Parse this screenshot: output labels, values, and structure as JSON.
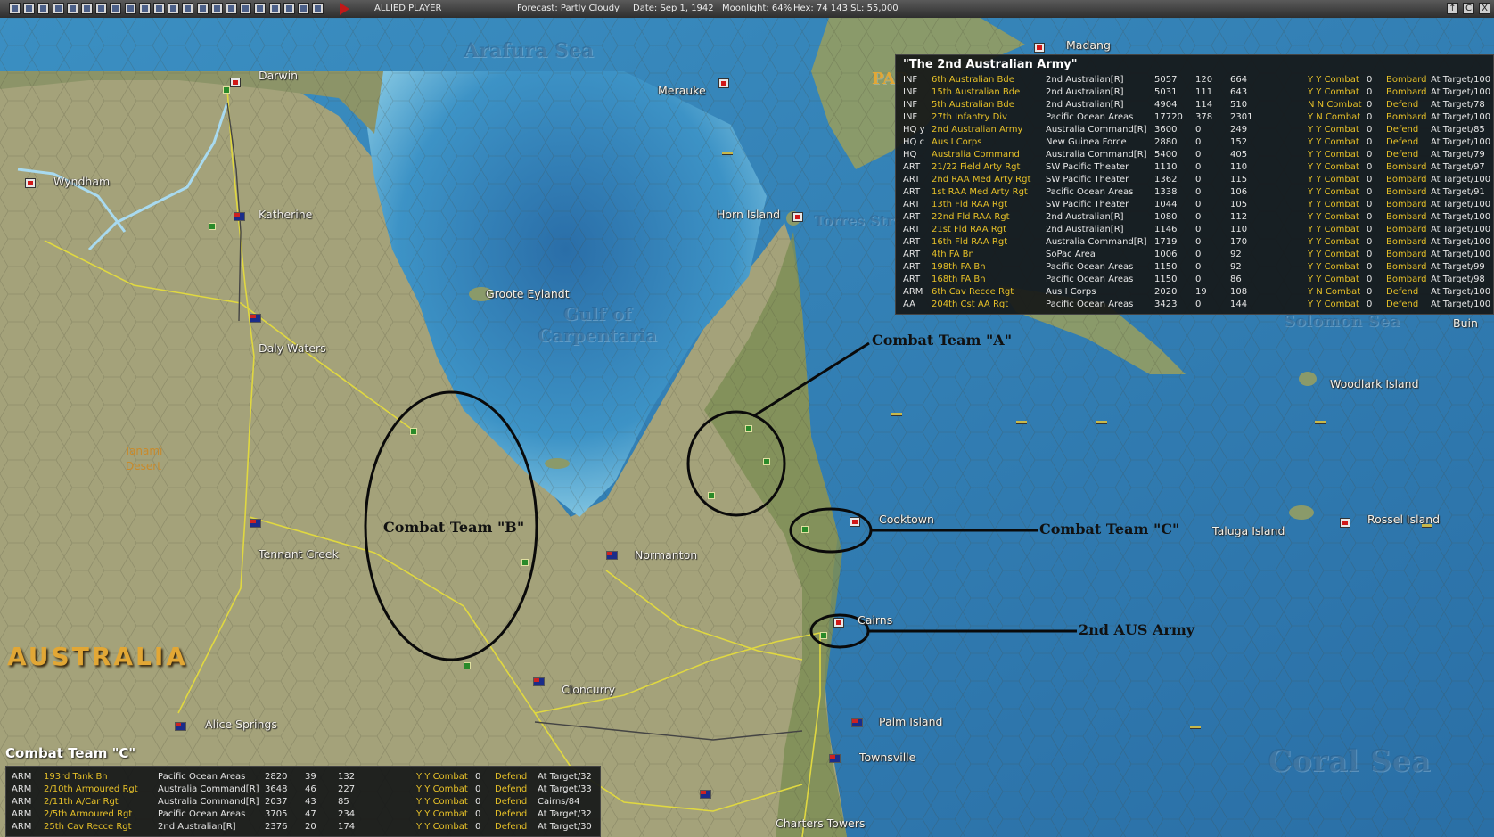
{
  "toolbar": {
    "player": "ALLIED PLAYER",
    "forecast": "Forecast: Partly Cloudy",
    "date": "Date: Sep 1, 1942",
    "moonlight": "Moonlight: 64%",
    "hex": "Hex: 74 143 SL: 55,000",
    "right_buttons": [
      "↑",
      "C",
      "X"
    ],
    "icon_count": 22
  },
  "map": {
    "places": [
      "Darwin",
      "Wyndham",
      "Katherine",
      "Daly Waters",
      "Tennant Creek",
      "Alice Springs",
      "Groote Eylandt",
      "Merauke",
      "Horn Island",
      "Normanton",
      "Cloncurry",
      "Cooktown",
      "Cairns",
      "Palm Island",
      "Townsville",
      "Charters Towers",
      "Taluga Island",
      "Rossel Island",
      "Woodlark Island",
      "Madang",
      "Buin"
    ],
    "seas": [
      "Arafura Sea",
      "Gulf of Carpentaria",
      "Torres Strait",
      "Coral Sea",
      "Solomon Sea"
    ],
    "partial_labels": [
      "PAP"
    ],
    "desert": "Tanami Desert",
    "country": "AUSTRALIA",
    "annotations": [
      "Combat Team \"A\"",
      "Combat Team \"B\"",
      "Combat Team \"C\"",
      "2nd AUS Army"
    ],
    "colors": {
      "sea": "#3a8fc4",
      "land": "#8c8a66",
      "road": "#e0d840",
      "river": "#9fd3ea"
    }
  },
  "army_panel": {
    "title": "\"The 2nd Australian Army\"",
    "rows": [
      [
        "INF",
        "6th Australian Bde",
        "2nd Australian[R]",
        "5057",
        "120",
        "664",
        "Y Y Combat",
        "0",
        "Bombard",
        "At Target/100"
      ],
      [
        "INF",
        "15th Australian Bde",
        "2nd Australian[R]",
        "5031",
        "111",
        "643",
        "Y Y Combat",
        "0",
        "Bombard",
        "At Target/100"
      ],
      [
        "INF",
        "5th Australian Bde",
        "2nd Australian[R]",
        "4904",
        "114",
        "510",
        "N N Combat",
        "0",
        "Defend",
        "At Target/78"
      ],
      [
        "INF",
        "27th Infantry Div",
        "Pacific Ocean Areas",
        "17720",
        "378",
        "2301",
        "Y N Combat",
        "0",
        "Bombard",
        "At Target/100"
      ],
      [
        "HQ y",
        "2nd Australian Army",
        "Australia Command[R]",
        "3600",
        "0",
        "249",
        "Y Y Combat",
        "0",
        "Defend",
        "At Target/85"
      ],
      [
        "HQ c",
        "Aus I Corps",
        "New Guinea Force",
        "2880",
        "0",
        "152",
        "Y Y Combat",
        "0",
        "Defend",
        "At Target/100"
      ],
      [
        "HQ",
        "Australia Command",
        "Australia Command[R]",
        "5400",
        "0",
        "405",
        "Y Y Combat",
        "0",
        "Defend",
        "At Target/79"
      ],
      [
        "ART",
        "21/22 Field Arty Rgt",
        "SW Pacific Theater",
        "1110",
        "0",
        "110",
        "Y Y Combat",
        "0",
        "Bombard",
        "At Target/97"
      ],
      [
        "ART",
        "2nd RAA Med Arty Rgt",
        "SW Pacific Theater",
        "1362",
        "0",
        "115",
        "Y Y Combat",
        "0",
        "Bombard",
        "At Target/100"
      ],
      [
        "ART",
        "1st RAA Med Arty Rgt",
        "Pacific Ocean Areas",
        "1338",
        "0",
        "106",
        "Y Y Combat",
        "0",
        "Bombard",
        "At Target/91"
      ],
      [
        "ART",
        "13th Fld RAA Rgt",
        "SW Pacific Theater",
        "1044",
        "0",
        "105",
        "Y Y Combat",
        "0",
        "Bombard",
        "At Target/100"
      ],
      [
        "ART",
        "22nd Fld RAA Rgt",
        "2nd Australian[R]",
        "1080",
        "0",
        "112",
        "Y Y Combat",
        "0",
        "Bombard",
        "At Target/100"
      ],
      [
        "ART",
        "21st Fld RAA Rgt",
        "2nd Australian[R]",
        "1146",
        "0",
        "110",
        "Y Y Combat",
        "0",
        "Bombard",
        "At Target/100"
      ],
      [
        "ART",
        "16th Fld RAA Rgt",
        "Australia Command[R]",
        "1719",
        "0",
        "170",
        "Y Y Combat",
        "0",
        "Bombard",
        "At Target/100"
      ],
      [
        "ART",
        "4th FA Bn",
        "SoPac Area",
        "1006",
        "0",
        "92",
        "Y Y Combat",
        "0",
        "Bombard",
        "At Target/100"
      ],
      [
        "ART",
        "198th FA Bn",
        "Pacific Ocean Areas",
        "1150",
        "0",
        "92",
        "Y Y Combat",
        "0",
        "Bombard",
        "At Target/99"
      ],
      [
        "ART",
        "168th FA Bn",
        "Pacific Ocean Areas",
        "1150",
        "0",
        "86",
        "Y Y Combat",
        "0",
        "Bombard",
        "At Target/98"
      ],
      [
        "ARM",
        "6th Cav Recce Rgt",
        "Aus I Corps",
        "2020",
        "19",
        "108",
        "Y N Combat",
        "0",
        "Defend",
        "At Target/100"
      ],
      [
        "AA",
        "204th Cst AA Rgt",
        "Pacific Ocean Areas",
        "3423",
        "0",
        "144",
        "Y Y Combat",
        "0",
        "Defend",
        "At Target/100"
      ]
    ]
  },
  "combat_team_panel": {
    "title": "Combat Team \"C\"",
    "rows": [
      [
        "ARM",
        "193rd Tank Bn",
        "Pacific Ocean Areas",
        "2820",
        "39",
        "132",
        "Y Y Combat",
        "0",
        "Defend",
        "At Target/32"
      ],
      [
        "ARM",
        "2/10th Armoured Rgt",
        "Australia Command[R]",
        "3648",
        "46",
        "227",
        "Y Y Combat",
        "0",
        "Defend",
        "At Target/33"
      ],
      [
        "ARM",
        "2/11th A/Car Rgt",
        "Australia Command[R]",
        "2037",
        "43",
        "85",
        "Y Y Combat",
        "0",
        "Defend",
        "Cairns/84"
      ],
      [
        "ARM",
        "2/5th Armoured Rgt",
        "Pacific Ocean Areas",
        "3705",
        "47",
        "234",
        "Y Y Combat",
        "0",
        "Defend",
        "At Target/32"
      ],
      [
        "ARM",
        "25th Cav Recce Rgt",
        "2nd Australian[R]",
        "2376",
        "20",
        "174",
        "Y Y Combat",
        "0",
        "Defend",
        "At Target/30"
      ]
    ]
  }
}
